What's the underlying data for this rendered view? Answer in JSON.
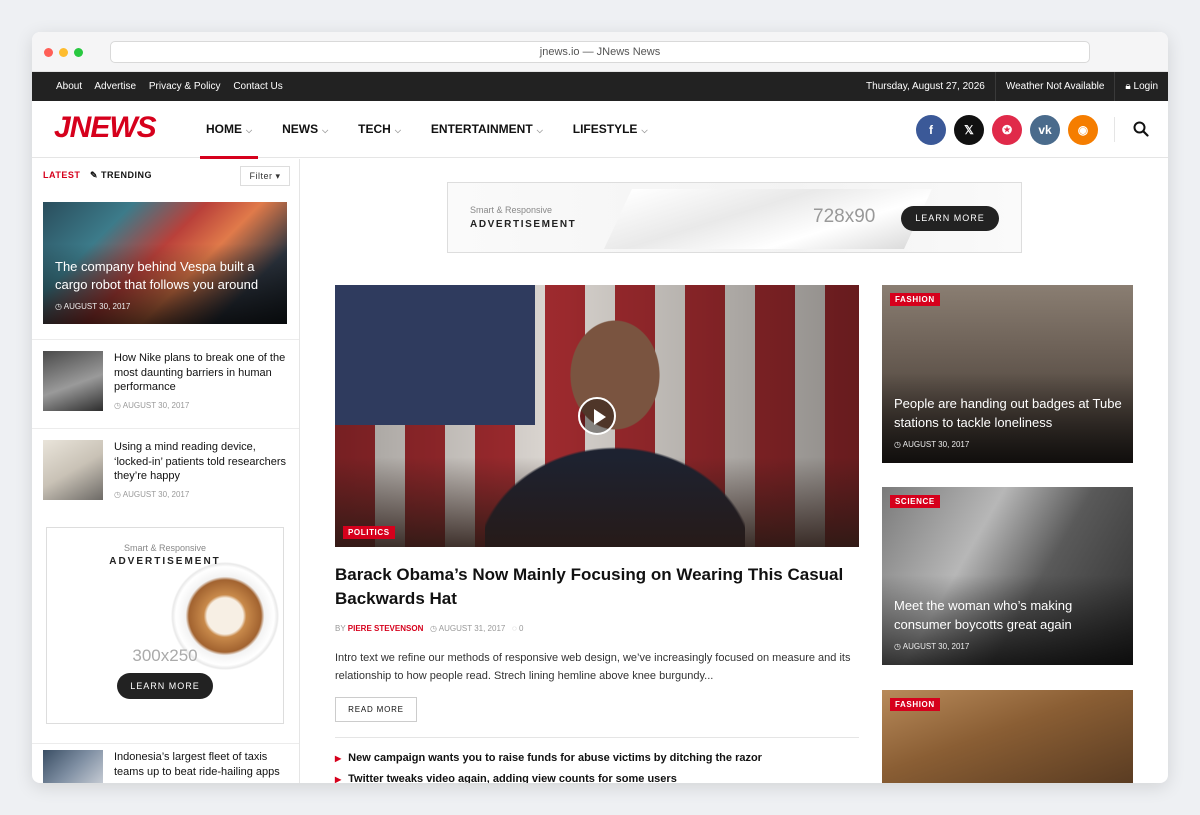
{
  "browser": {
    "url": "jnews.io — JNews News"
  },
  "topbar": {
    "links": [
      "About",
      "Advertise",
      "Privacy & Policy",
      "Contact Us"
    ],
    "date": "Thursday, August 27, 2026",
    "weather": "Weather Not Available",
    "login": "Login"
  },
  "header": {
    "logo": "JNEWS",
    "nav": [
      "HOME",
      "NEWS",
      "TECH",
      "ENTERTAINMENT",
      "LIFESTYLE"
    ],
    "social": [
      {
        "name": "facebook",
        "glyph": "f",
        "color": "#3b5998"
      },
      {
        "name": "x",
        "glyph": "𝕏",
        "color": "#111111"
      },
      {
        "name": "pinterest",
        "glyph": "✪",
        "color": "#e02a4a"
      },
      {
        "name": "vk",
        "glyph": "vk",
        "color": "#4a6b8c"
      },
      {
        "name": "rss",
        "glyph": "◉",
        "color": "#f57d00"
      }
    ]
  },
  "sidebar": {
    "tab_latest": "LATEST",
    "tab_trending": "TRENDING",
    "filter": "Filter",
    "featured": {
      "title": "The company behind Vespa built a cargo robot that follows you around",
      "date": "AUGUST 30, 2017"
    },
    "items": [
      {
        "title": "How Nike plans to break one of the most daunting barriers in human performance",
        "date": "AUGUST 30, 2017"
      },
      {
        "title": "Using a mind reading device, ‘locked-in’ patients told researchers they’re happy",
        "date": "AUGUST 30, 2017"
      }
    ],
    "ad": {
      "small": "Smart & Responsive",
      "big": "ADVERTISEMENT",
      "size": "300x250",
      "button": "LEARN MORE"
    },
    "last_item": {
      "title": "Indonesia’s largest fleet of taxis teams up to beat ride-hailing apps"
    }
  },
  "banner": {
    "small": "Smart & Responsive",
    "big": "ADVERTISEMENT",
    "size": "728x90",
    "button": "LEARN MORE"
  },
  "main": {
    "category": "POLITICS",
    "title": "Barack Obama’s Now Mainly Focusing on Wearing This Casual Backwards Hat",
    "by": "BY",
    "author": "PIERE STEVENSON",
    "date": "AUGUST 31, 2017",
    "comments": "0",
    "intro": "Intro text we refine our methods of responsive web design, we’ve increasingly focused on measure and its relationship to how people read. Strech lining hemline above knee burgundy...",
    "read_more": "READ MORE",
    "related": [
      "New campaign wants you to raise funds for abuse victims by ditching the razor",
      "Twitter tweaks video again, adding view counts for some users"
    ]
  },
  "cards": [
    {
      "category": "FASHION",
      "title": "People are handing out badges at Tube stations to tackle loneliness",
      "date": "AUGUST 30, 2017"
    },
    {
      "category": "SCIENCE",
      "title": "Meet the woman who’s making consumer boycotts great again",
      "date": "AUGUST 30, 2017"
    },
    {
      "category": "FASHION"
    }
  ],
  "colors": {
    "accent": "#d6001c",
    "topbar": "#222222"
  }
}
